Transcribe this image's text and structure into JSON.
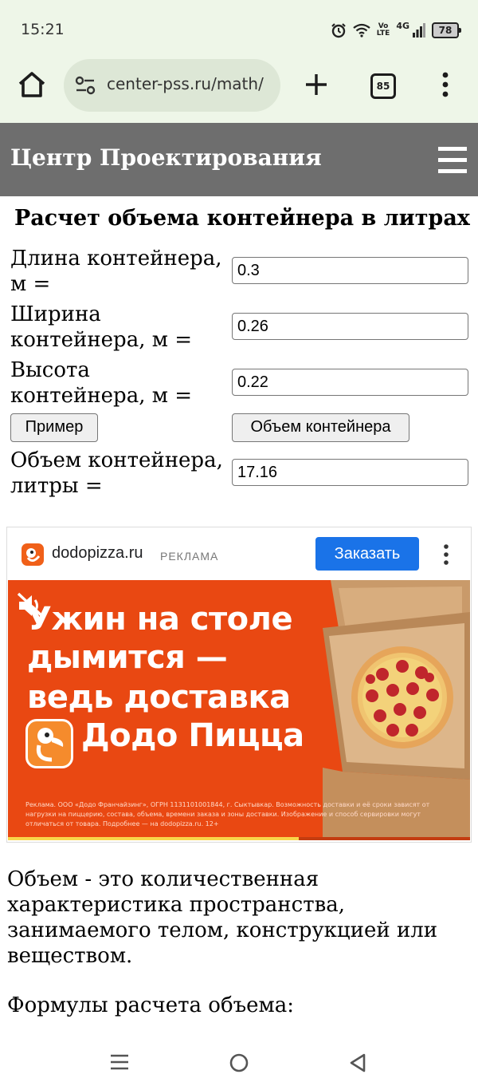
{
  "status_bar": {
    "time": "15:21",
    "network_volte": "Vo\nLTE",
    "network_type": "4G",
    "battery": "78"
  },
  "browser": {
    "url": "center-pss.ru/math/",
    "tab_count": "85",
    "icons": [
      "home-icon",
      "site-settings-icon",
      "plus-icon",
      "tabs-icon",
      "more-vert-icon"
    ]
  },
  "site": {
    "title": "Центр Проектирования"
  },
  "calculator": {
    "title": "Расчет объема контейнера в литрах",
    "length_label": "Длина контейнера, м =",
    "length_value": "0.3",
    "width_label": "Ширина контейнера, м =",
    "width_value": "0.26",
    "height_label": "Высота контейнера, м =",
    "height_value": "0.22",
    "example_button": "Пример",
    "calculate_button": "Объем контейнера",
    "result_label": "Объем контейнера, литры =",
    "result_value": "17.16"
  },
  "ad": {
    "domain": "dodopizza.ru",
    "tag": "РЕКЛАМА",
    "cta": "Заказать",
    "headline_1": "Ужин на столе",
    "headline_2": "дымится —",
    "headline_3": "ведь доставка",
    "headline_4": "Додо Пицца",
    "disclaimer": "Реклама. ООО «Додо Франчайзинг», ОГРН 1131101001844, г. Сыктывкар. Возможность доставки и её сроки зависят от нагрузки на пиццерию, состава, объема, времени заказа и зоны доставки. Изображение и способ сервировки могут отличаться от товара. Подробнее — на dodopizza.ru. 12+",
    "progress": 0.63,
    "colors": {
      "banner": "#e94812",
      "cta": "#1a73e8"
    }
  },
  "article": {
    "paragraph_1": "Объем - это количественная характеристика пространства, занимаемого телом, конструкцией или веществом.",
    "paragraph_2": "Формулы расчета объема:"
  }
}
